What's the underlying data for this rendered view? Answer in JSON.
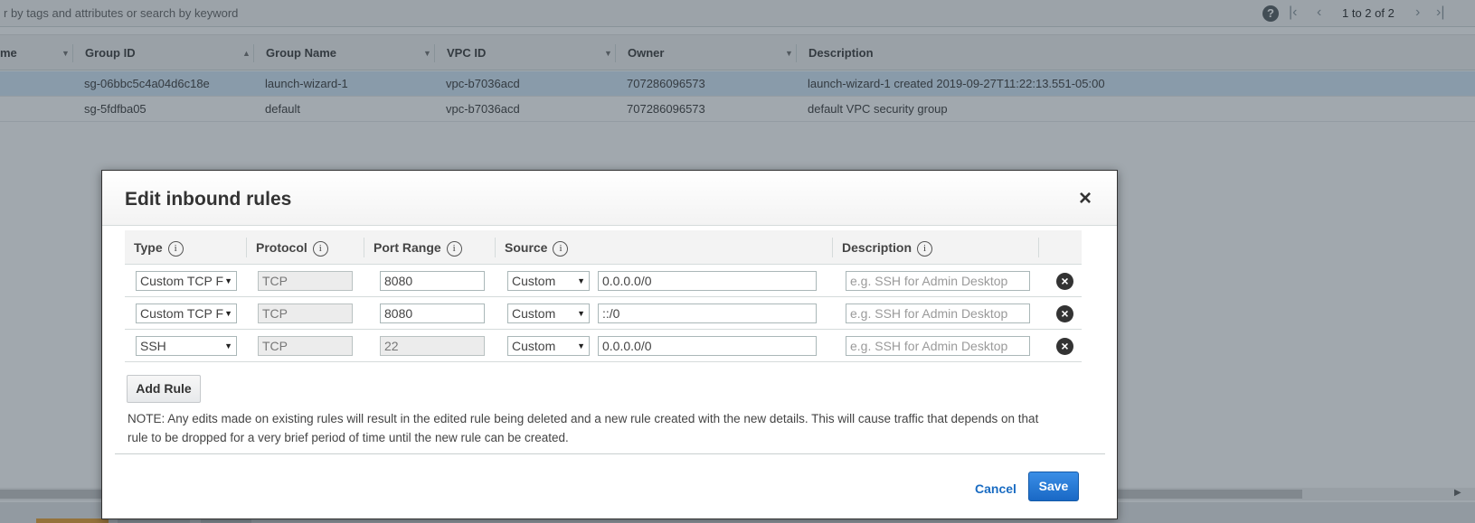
{
  "filter": {
    "placeholder": "r by tags and attributes or search by keyword",
    "pagination": "1 to 2 of 2",
    "help": "?",
    "first": "|‹",
    "prev": "‹",
    "next": "›",
    "last": "›|"
  },
  "grid": {
    "columns": [
      "me",
      "Group ID",
      "Group Name",
      "VPC ID",
      "Owner",
      "Description"
    ],
    "rows": [
      {
        "group_id": "sg-06bbc5c4a04d6c18e",
        "group_name": "launch-wizard-1",
        "vpc_id": "vpc-b7036acd",
        "owner": "707286096573",
        "description": "launch-wizard-1 created 2019-09-27T11:22:13.551-05:00"
      },
      {
        "group_id": "sg-5fdfba05",
        "group_name": "default",
        "vpc_id": "vpc-b7036acd",
        "owner": "707286096573",
        "description": "default VPC security group"
      }
    ]
  },
  "modal": {
    "title": "Edit inbound rules",
    "close": "×",
    "headers": {
      "type": "Type",
      "protocol": "Protocol",
      "port_range": "Port Range",
      "source": "Source",
      "description": "Description"
    },
    "info_glyph": "i",
    "rules": [
      {
        "type": "Custom TCP F",
        "protocol": "TCP",
        "port_range": "8080",
        "source_type": "Custom",
        "source": "0.0.0.0/0",
        "description_placeholder": "e.g. SSH for Admin Desktop"
      },
      {
        "type": "Custom TCP F",
        "protocol": "TCP",
        "port_range": "8080",
        "source_type": "Custom",
        "source": "::/0",
        "description_placeholder": "e.g. SSH for Admin Desktop"
      },
      {
        "type": "SSH",
        "protocol": "TCP",
        "port_range": "22",
        "source_type": "Custom",
        "source": "0.0.0.0/0",
        "description_placeholder": "e.g. SSH for Admin Desktop"
      }
    ],
    "add_rule": "Add Rule",
    "note": "NOTE: Any edits made on existing rules will result in the edited rule being deleted and a new rule created with the new details. This will cause traffic that depends on that rule to be dropped for a very brief period of time until the new rule can be created.",
    "cancel": "Cancel",
    "save": "Save"
  },
  "colors": {
    "accent": "#1968c5",
    "link": "#1a6cc2",
    "selected_row": "#d6e8f8"
  }
}
